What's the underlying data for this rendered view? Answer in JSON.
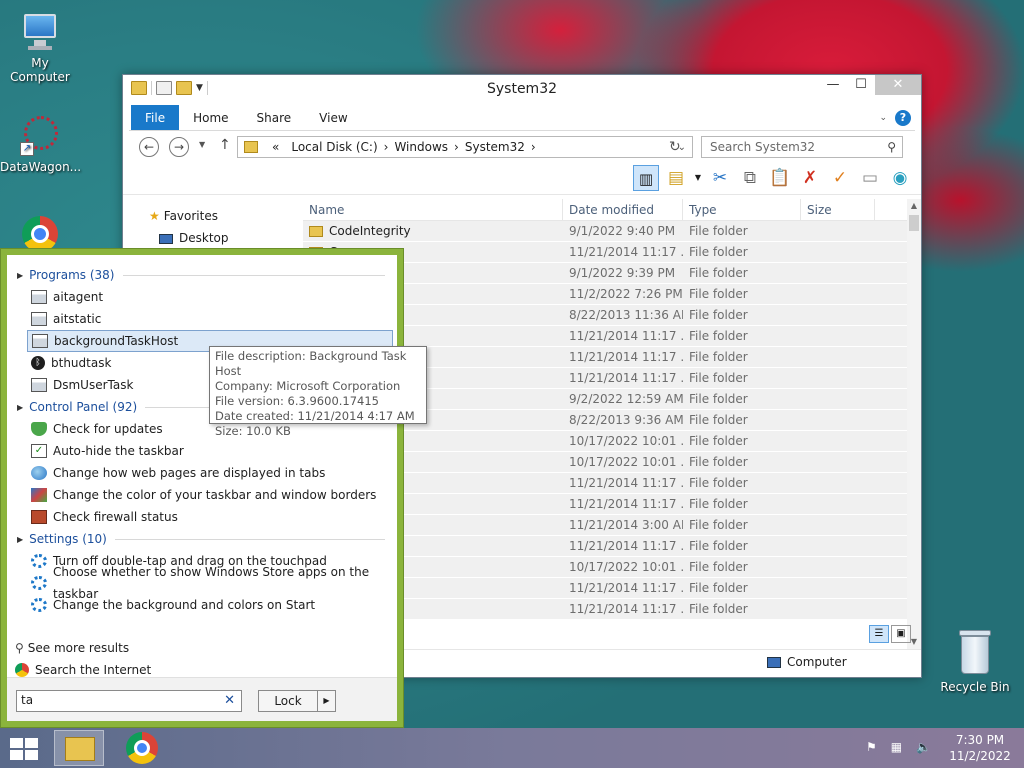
{
  "desktop": {
    "icons": [
      {
        "label": "My Computer"
      },
      {
        "label": "DataWagon..."
      },
      {
        "label": "Recycle Bin"
      }
    ]
  },
  "explorer": {
    "title": "System32",
    "ribbon_tabs": [
      "File",
      "Home",
      "Share",
      "View"
    ],
    "address": {
      "prefix": "«",
      "segments": [
        "Local Disk (C:)",
        "Windows",
        "System32"
      ]
    },
    "search_placeholder": "Search System32",
    "nav": {
      "favorites": "Favorites",
      "desktop": "Desktop"
    },
    "columns": [
      "Name",
      "Date modified",
      "Type",
      "Size"
    ],
    "rows": [
      {
        "name": "CodeIntegrity",
        "date": "9/1/2022 9:40 PM",
        "type": "File folder"
      },
      {
        "name": "Com",
        "date": "11/21/2014 11:17 ...",
        "type": "File folder"
      },
      {
        "name": "",
        "date": "9/1/2022 9:39 PM",
        "type": "File folder"
      },
      {
        "name": "",
        "date": "11/2/2022 7:26 PM",
        "type": "File folder"
      },
      {
        "name": "",
        "date": "8/22/2013 11:36 AM",
        "type": "File folder"
      },
      {
        "name": "",
        "date": "11/21/2014 11:17 ...",
        "type": "File folder"
      },
      {
        "name": "",
        "date": "11/21/2014 11:17 ...",
        "type": "File folder"
      },
      {
        "name": "",
        "date": "11/21/2014 11:17 ...",
        "type": "File folder"
      },
      {
        "name": "",
        "date": "9/2/2022 12:59 AM",
        "type": "File folder"
      },
      {
        "name": "",
        "date": "8/22/2013 9:36 AM",
        "type": "File folder"
      },
      {
        "name": "",
        "date": "10/17/2022 10:01 ...",
        "type": "File folder"
      },
      {
        "name": "",
        "date": "10/17/2022 10:01 ...",
        "type": "File folder"
      },
      {
        "name": "",
        "date": "11/21/2014 11:17 ...",
        "type": "File folder"
      },
      {
        "name": "",
        "date": "11/21/2014 11:17 ...",
        "type": "File folder"
      },
      {
        "name": "",
        "date": "11/21/2014 3:00 AM",
        "type": "File folder"
      },
      {
        "name": "",
        "date": "11/21/2014 11:17 ...",
        "type": "File folder"
      },
      {
        "name": "",
        "date": "10/17/2022 10:01 ...",
        "type": "File folder"
      },
      {
        "name": "",
        "date": "11/21/2014 11:17 ...",
        "type": "File folder"
      },
      {
        "name": "",
        "date": "11/21/2014 11:17 ...",
        "type": "File folder"
      }
    ],
    "status": "Computer"
  },
  "start_search": {
    "groups": {
      "programs": "Programs (38)",
      "control_panel": "Control Panel (92)",
      "settings": "Settings (10)"
    },
    "programs": [
      "aitagent",
      "aitstatic",
      "backgroundTaskHost",
      "bthudtask",
      "DsmUserTask"
    ],
    "control_panel": [
      "Check for updates",
      "Auto-hide the taskbar",
      "Change how web pages are displayed in tabs",
      "Change the color of your taskbar and window borders",
      "Check firewall status"
    ],
    "settings": [
      "Turn off double-tap and drag on the touchpad",
      "Choose whether to show Windows Store apps on the taskbar",
      "Change the background and colors on Start"
    ],
    "see_more": "See more results",
    "search_internet": "Search the Internet",
    "query": "ta",
    "lock_label": "Lock"
  },
  "tooltip": {
    "description": "File description: Background Task Host",
    "company": "Company: Microsoft Corporation",
    "version": "File version: 6.3.9600.17415",
    "created": "Date created: 11/21/2014 4:17 AM",
    "size": "Size: 10.0 KB"
  },
  "taskbar": {
    "time": "7:30 PM",
    "date": "11/2/2022"
  }
}
